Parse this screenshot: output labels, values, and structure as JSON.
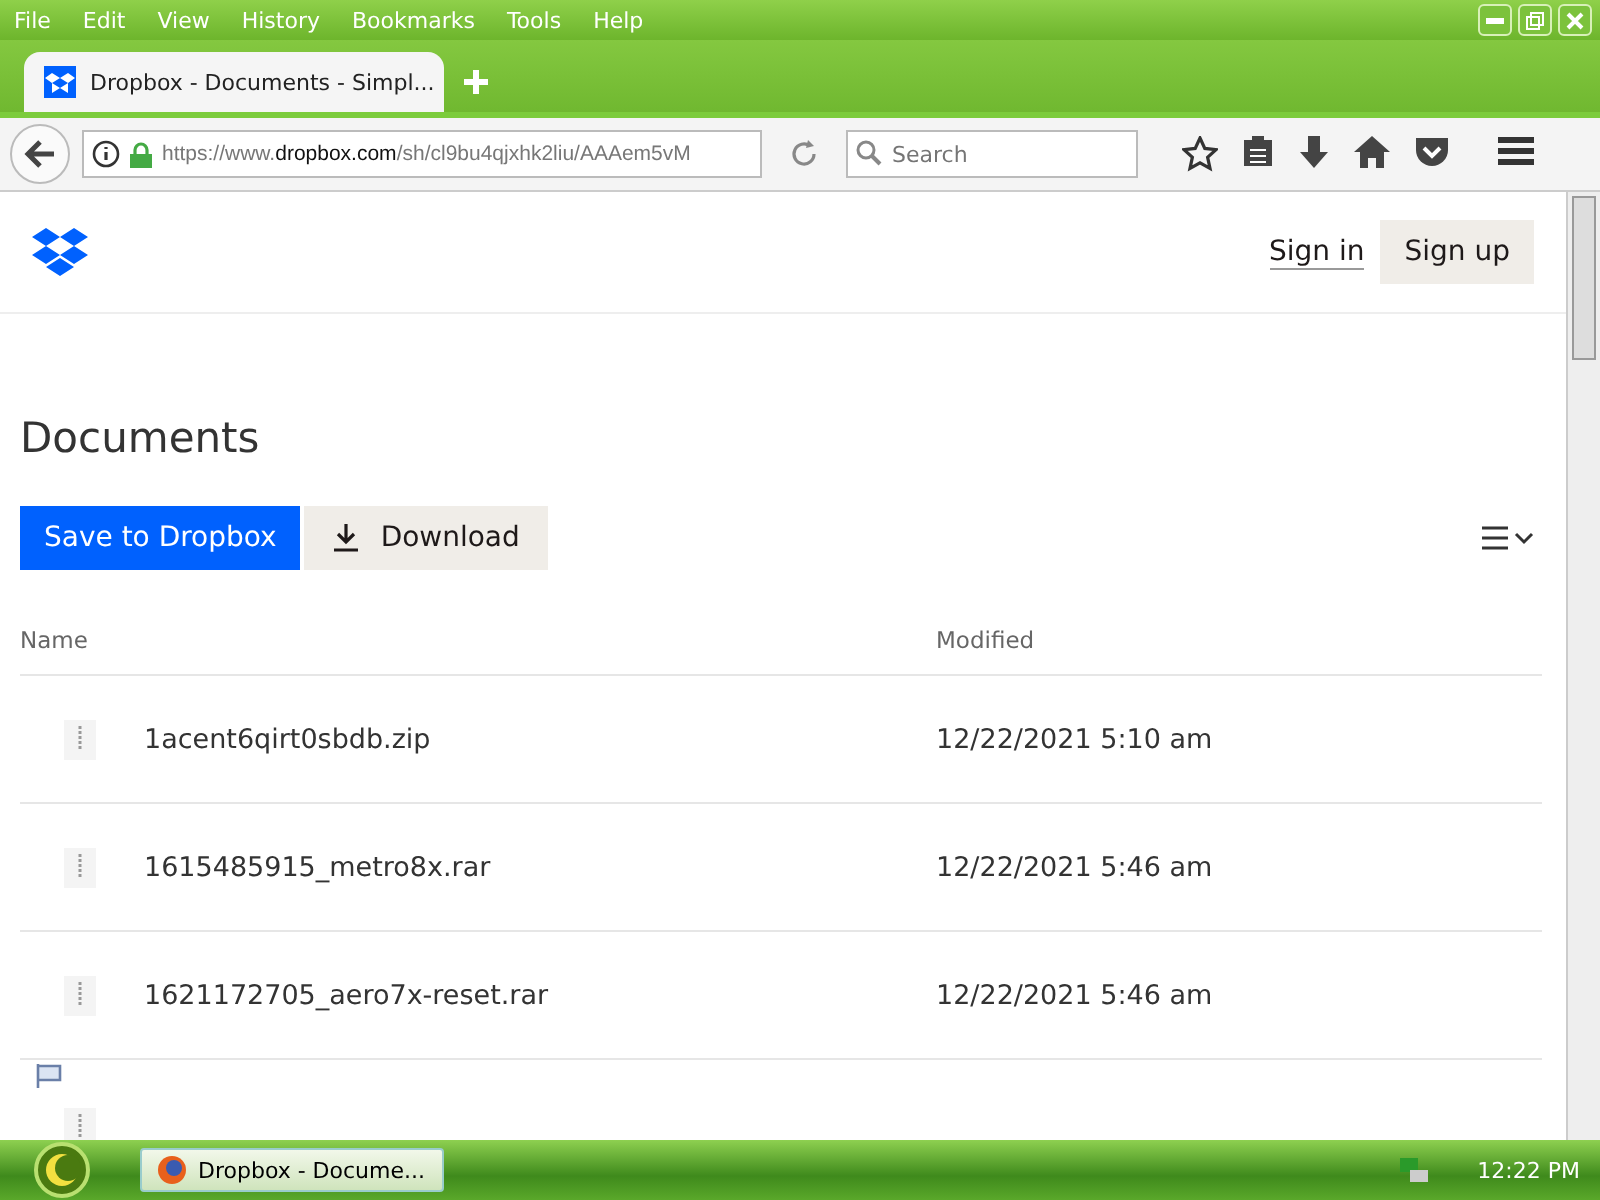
{
  "menu": [
    "File",
    "Edit",
    "View",
    "History",
    "Bookmarks",
    "Tools",
    "Help"
  ],
  "tabs": [
    {
      "title": "Dropbox - Documents - Simpl...",
      "selected": true
    }
  ],
  "address": "https://www.**dropbox.com**/sh/cl9bu4qjxhk2liu/AAAem5vM",
  "search": {
    "placeholder": "Search"
  },
  "page": {
    "sign_in": "Sign in",
    "sign_up": "Sign up",
    "title": "Documents",
    "save_button": "Save to Dropbox",
    "download_button": "Download",
    "columns": [
      "Name",
      "Modified"
    ],
    "rows": [
      {
        "name": "1acent6qirt0sbdb.zip",
        "modified": "12/22/2021 5:10 am"
      },
      {
        "name": "1615485915_metro8x.rar",
        "modified": "12/22/2021 5:46 am"
      },
      {
        "name": "1621172705_aero7x-reset.rar",
        "modified": "12/22/2021 5:46 am"
      }
    ]
  },
  "taskbar": {
    "tasks": [
      "Dropbox - Docume..."
    ],
    "clock": "12:22 PM"
  }
}
